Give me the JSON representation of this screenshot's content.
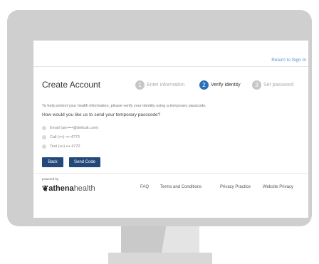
{
  "header": {
    "return_link": "Return to Sign In"
  },
  "page": {
    "title": "Create Account"
  },
  "steps": [
    {
      "number": "1",
      "label": "Enter information",
      "state": "inactive"
    },
    {
      "number": "2",
      "label": "Verify identity",
      "state": "active"
    },
    {
      "number": "3",
      "label": "Set password",
      "state": "inactive"
    }
  ],
  "verify": {
    "help_text": "To help protect your health information, please verify your identity using a temporary passcode.",
    "question": "How would you like us to send your temporary passcode?",
    "options": [
      "Email (am••••@default.com)",
      "Call (•••) •••-4770",
      "Text (•••) •••-4770"
    ]
  },
  "buttons": {
    "back": "Back",
    "send_code": "Send Code"
  },
  "footer": {
    "powered_by": "powered by",
    "logo_mark": "❦",
    "logo_bold": "athena",
    "logo_light": "health",
    "links": [
      "FAQ",
      "Terms and Conditions",
      "Privacy Practice",
      "Website Privacy"
    ]
  }
}
